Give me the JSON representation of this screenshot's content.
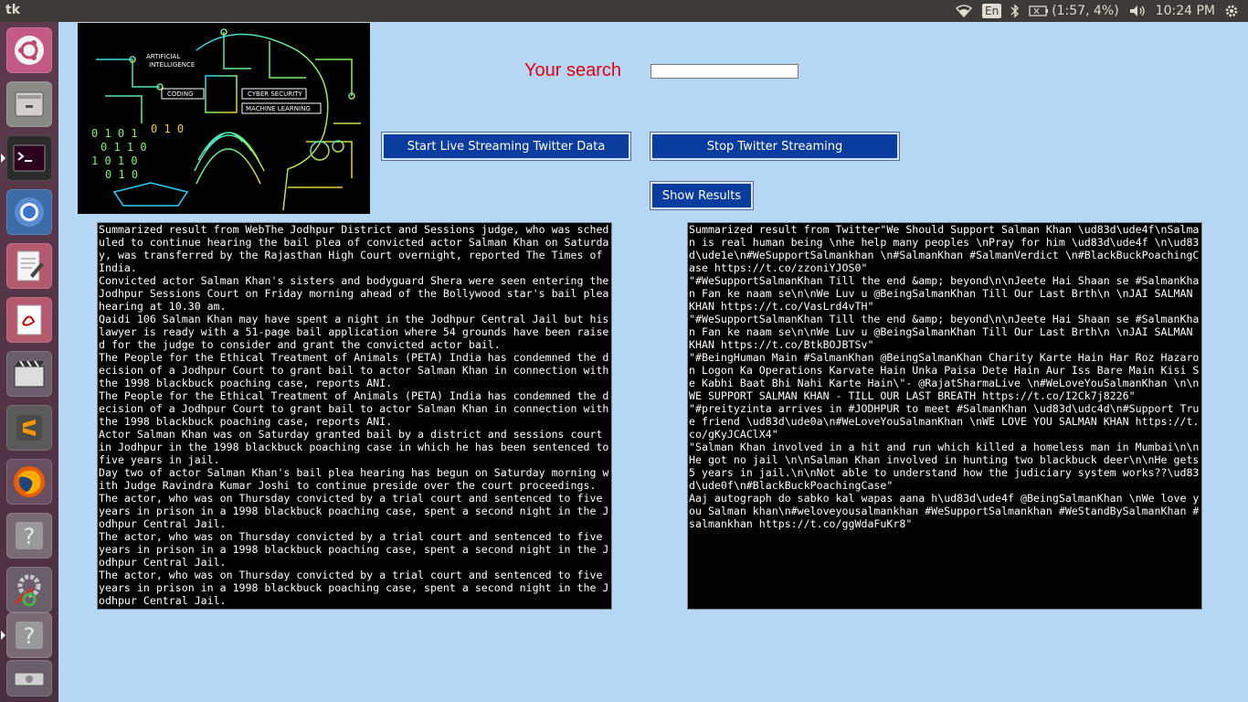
{
  "topbar": {
    "app_title": "tk",
    "keyboard_layout": "En",
    "battery_text": "(1:57, 4%)",
    "clock": "10:24 PM"
  },
  "launcher": {
    "items": [
      "ubuntu-logo-icon",
      "files-icon",
      "terminal-icon",
      "chromium-icon",
      "text-editor-icon",
      "document-viewer-icon",
      "video-editor-icon",
      "sublime-text-icon",
      "firefox-icon",
      "unknown-app-icon",
      "system-settings-icon",
      "unknown-app-icon",
      "disk-drive-icon"
    ]
  },
  "banner": {
    "words": [
      "ARTIFICIAL",
      "INTELLIGENCE",
      "CODING",
      "CYBER SECURITY",
      "MACHINE LEARNING"
    ]
  },
  "search": {
    "label": "Your search",
    "value": "",
    "placeholder": ""
  },
  "buttons": {
    "start_stream": "Start Live Streaming Twitter Data",
    "stop_stream": "Stop Twitter Streaming",
    "show_results": "Show Results"
  },
  "web_results": {
    "text": "Summarized result from WebThe Jodhpur District and Sessions judge, who was scheduled to continue hearing the bail plea of convicted actor Salman Khan on Saturday, was transferred by the Rajasthan High Court overnight, reported The Times of India.\nConvicted actor Salman Khan's sisters and bodyguard Shera were seen entering the Jodhpur Sessions Court on Friday morning ahead of the Bollywood star's bail plea hearing at 10.30 am.\nQaidi 106 Salman Khan may have spent a night in the Jodhpur Central Jail but his lawyer is ready with a 51-page bail application where 54 grounds have been raised for the judge to consider and grant the convicted actor bail.\nThe People for the Ethical Treatment of Animals (PETA) India has condemned the decision of a Jodhpur Court to grant bail to actor Salman Khan in connection with the 1998 blackbuck poaching case, reports ANI.\nThe People for the Ethical Treatment of Animals (PETA) India has condemned the decision of a Jodhpur Court to grant bail to actor Salman Khan in connection with the 1998 blackbuck poaching case, reports ANI.\nActor Salman Khan was on Saturday granted bail by a district and sessions court in Jodhpur in the 1998 blackbuck poaching case in which he has been sentenced to five years in jail.\nDay two of actor Salman Khan's bail plea hearing has begun on Saturday morning with Judge Ravindra Kumar Joshi to continue preside over the court proceedings.\nThe actor, who was on Thursday convicted by a trial court and sentenced to five years in prison in a 1998 blackbuck poaching case, spent a second night in the Jodhpur Central Jail.\nThe actor, who was on Thursday convicted by a trial court and sentenced to five years in prison in a 1998 blackbuck poaching case, spent a second night in the Jodhpur Central Jail.\nThe actor, who was on Thursday convicted by a trial court and sentenced to five years in prison in a 1998 blackbuck poaching case, spent a second night in the Jodhpur Central Jail."
  },
  "twitter_results": {
    "text": "Summarized result from Twitter\"We Should Support Salman Khan \\ud83d\\ude4f\\nSalman is real human being \\nhe help many peoples \\nPray for him \\ud83d\\ude4f \\n\\ud83d\\ude1e\\n#WeSupportSalmankhan \\n#SalmanKhan #SalmanVerdict \\n#BlackBuckPoachingCase https://t.co/zzoniYJOS0\"\n\"#WeSupportSalmanKhan Till the end &amp; beyond\\n\\nJeete Hai Shaan se #SalmanKhan Fan ke naam se\\n\\nWe Luv u @BeingSalmanKhan Till Our Last Brth\\n \\nJAI SALMAN KHAN https://t.co/VasLrd4vTH\"\n\"#WeSupportSalmanKhan Till the end &amp; beyond\\n\\nJeete Hai Shaan se #SalmanKhan Fan ke naam se\\n\\nWe Luv u @BeingSalmanKhan Till Our Last Brth\\n \\nJAI SALMAN KHAN https://t.co/BtkBOJBTSv\"\n\"#BeingHuman Main #SalmanKhan @BeingSalmanKhan Charity Karte Hain Har Roz Hazaron Logon Ka Operations Karvate Hain Unka Paisa Dete Hain Aur Iss Bare Main Kisi Se Kabhi Baat Bhi Nahi Karte Hain\\\"- @RajatSharmaLive \\n#WeLoveYouSalmanKhan \\n\\nWE SUPPORT SALMAN KHAN - TILL OUR LAST BREATH https://t.co/I2Ck7j8226\"\n\"#preityzinta arrives in #JODHPUR to meet #SalmanKhan \\ud83d\\udc4d\\n#Support True friend \\ud83d\\ude0a\\n#WeLoveYouSalmanKhan \\nWE LOVE YOU SALMAN KHAN https://t.co/gKyJCAClX4\"\n\"Salman Khan involved in a hit and run which killed a homeless man in Mumbai\\n\\nHe got no jail \\n\\nSalman Khan involved in hunting two blackbuck deer\\n\\nHe gets 5 years in jail.\\n\\nNot able to understand how the judiciary system works??\\ud83d\\ude0f\\n#BlackBuckPoachingCase\"\nAaj autograph do sabko kal wapas aana h\\ud83d\\ude4f @BeingSalmanKhan \\nWe love you Salman khan\\n#weloveyousalmankhan #WeSupportSalmankhan #WeStandBySalmanKhan #salmankhan https://t.co/ggWdaFuKr8\""
  },
  "colors": {
    "background": "#b6d7f3",
    "button": "#0a3d9e",
    "search_label": "#e4000f",
    "panel": "#000000"
  }
}
